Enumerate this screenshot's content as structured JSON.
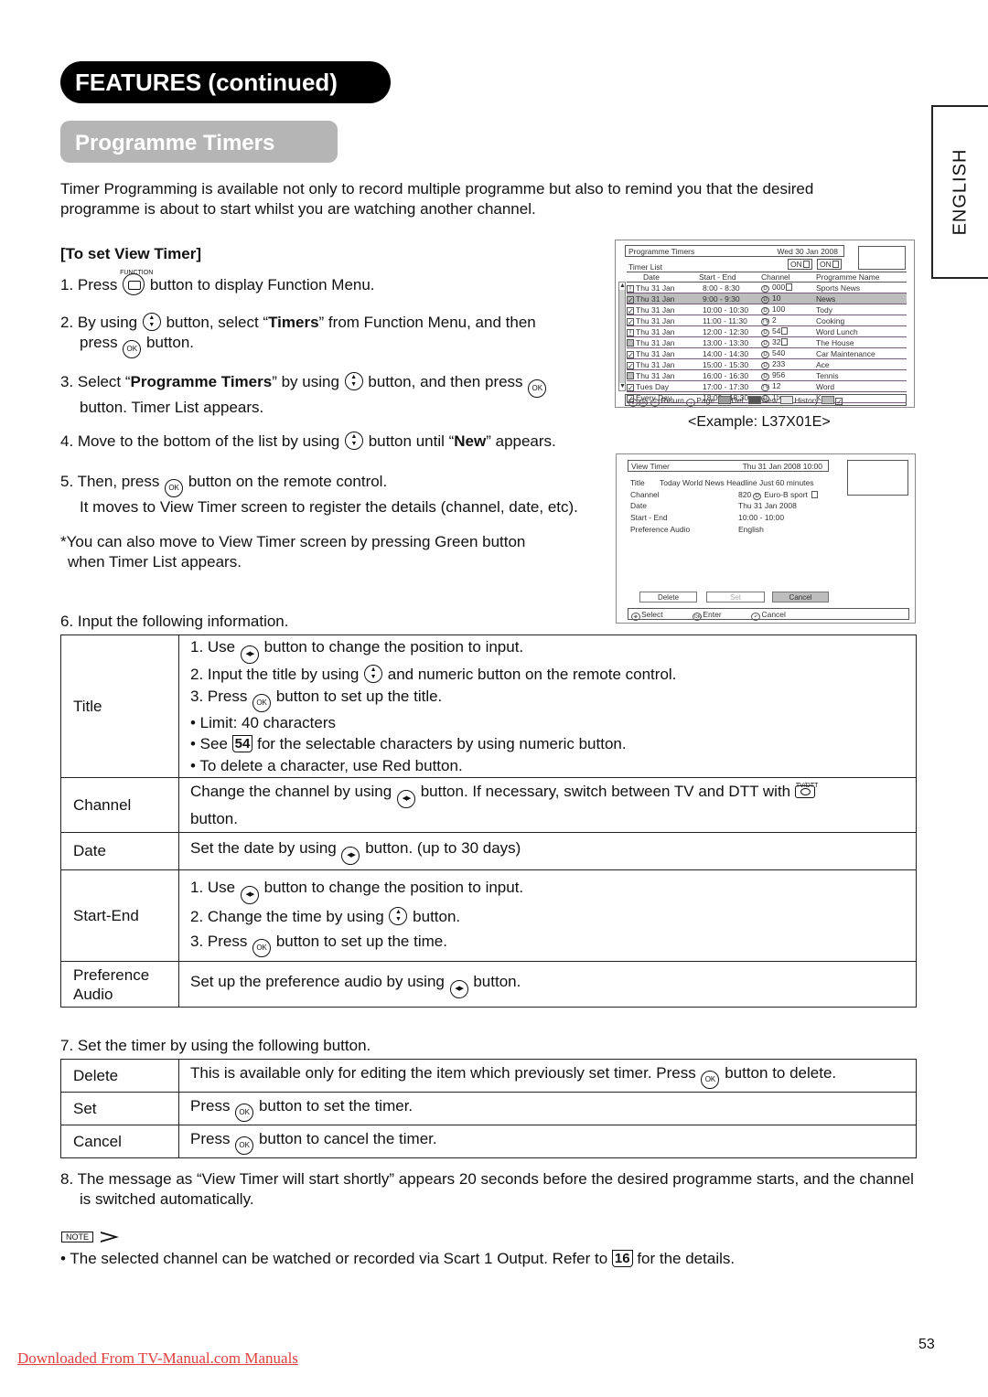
{
  "header": {
    "section_title": "FEATURES (continued)",
    "subsection_title": "Programme Timers",
    "language_tab": "ENGLISH"
  },
  "intro": "Timer Programming is available not only to record multiple programme but also to remind you that the desired programme is about to start whilst you are watching another channel.",
  "view_timer_heading": "[To set View Timer]",
  "icons": {
    "function_label": "FUNCTION",
    "ok_label": "OK",
    "tvdtt_label": "TV/DTT"
  },
  "steps": {
    "s1_a": "1. Press",
    "s1_b": "button to display Function Menu.",
    "s2_a": "2. By using",
    "s2_b": "button, select “",
    "s2_bold": "Timers",
    "s2_c": "” from Function Menu, and then",
    "s2_d": "press",
    "s2_e": "button.",
    "s3_a": "3. Select “",
    "s3_bold": "Programme Timers",
    "s3_b": "” by using",
    "s3_c": "button, and then press",
    "s3_d": "button. Timer List appears.",
    "s4_a": "4. Move to the bottom of the list by using",
    "s4_b": "button until “",
    "s4_bold": "New",
    "s4_c": "” appears.",
    "s5_a": "5. Then, press",
    "s5_b": "button on the remote control.",
    "s5_c": "It moves to View Timer screen to register the details (channel, date, etc).",
    "s5_note_1": "*You can also move to View Timer screen by pressing Green button",
    "s5_note_2": "when Timer List appears.",
    "s6": "6. Input the following information.",
    "s7": "7. Set the timer by using the following button.",
    "s8": "8. The message as “View Timer will start shortly” appears 20 seconds before the desired programme starts, and the channel is switched automatically."
  },
  "timer_list_screen": {
    "title": "Programme Timers",
    "date": "Wed 30 Jan 2008",
    "subtitle": "Timer List",
    "lock_badges": [
      "ON",
      "ON"
    ],
    "columns": [
      "Date",
      "Start - End",
      "Channel",
      "Programme Name"
    ],
    "rows": [
      {
        "mark": "!",
        "date": "Thu  31  Jan",
        "time": "8:00 -   8:30",
        "src": "D",
        "channel": "000",
        "lock": true,
        "name": "Sports News",
        "selected": false
      },
      {
        "mark": "check",
        "date": "Thu  31  Jan",
        "time": "9:00 -   9:30",
        "src": "D",
        "channel": "10",
        "lock": false,
        "name": "News",
        "selected": true
      },
      {
        "mark": "check",
        "date": "Thu  31  Jan",
        "time": "10:00 - 10:30",
        "src": "D",
        "channel": "100",
        "lock": false,
        "name": "Tody",
        "selected": false
      },
      {
        "mark": "check",
        "date": "Thu  31  Jan",
        "time": "11:00 - 11:30",
        "src": "TV",
        "channel": "2",
        "lock": false,
        "name": "Cooking",
        "selected": false
      },
      {
        "mark": "!",
        "date": "Thu  31  Jan",
        "time": "12:00 - 12:30",
        "src": "D",
        "channel": "54",
        "lock": true,
        "name": "Word Lunch",
        "selected": false
      },
      {
        "mark": "grey",
        "date": "Thu  31  Jan",
        "time": "13:00 - 13:30",
        "src": "D",
        "channel": "32",
        "lock": true,
        "name": "The House",
        "selected": false
      },
      {
        "mark": "check",
        "date": "Thu  31  Jan",
        "time": "14:00 - 14:30",
        "src": "D",
        "channel": "540",
        "lock": false,
        "name": "Car Maintenance",
        "selected": false
      },
      {
        "mark": "check",
        "date": "Thu  31  Jan",
        "time": "15:00 - 15:30",
        "src": "D",
        "channel": "233",
        "lock": false,
        "name": "Ace",
        "selected": false
      },
      {
        "mark": "grey",
        "date": "Thu  31  Jan",
        "time": "16:00 - 16:30",
        "src": "D",
        "channel": "956",
        "lock": false,
        "name": "Tennis",
        "selected": false
      },
      {
        "mark": "check",
        "date": "Tues Day",
        "time": "17:00 - 17:30",
        "src": "TV",
        "channel": "12",
        "lock": false,
        "name": "Word",
        "selected": false
      },
      {
        "mark": "check",
        "date": "Every Day",
        "time": "18:00 - 18:30",
        "src": "D",
        "channel": "15",
        "lock": false,
        "name": "K",
        "selected": false
      }
    ],
    "footer": {
      "ok": "OK",
      "return": "Return",
      "page": "Page",
      "del": "Del.",
      "new": "New",
      "history": "History"
    },
    "caption": "<Example: L37X01E>"
  },
  "view_timer_screen": {
    "title": "View Timer",
    "datetime": "Thu 31 Jan 2008    10:00",
    "title_label": "Title",
    "title_value": "Today World News Headline Just 60 minutes",
    "fields": [
      {
        "label": "Channel",
        "value": "820",
        "extra": "Euro-B sport"
      },
      {
        "label": "Date",
        "value": "Thu 31 Jan 2008",
        "extra": ""
      },
      {
        "label": "Start - End",
        "value": "10:00 - 10:00",
        "extra": ""
      },
      {
        "label": "Preference Audio",
        "value": "English",
        "extra": ""
      }
    ],
    "buttons": [
      "Delete",
      "Set",
      "Cancel"
    ],
    "footer": {
      "select": "Select",
      "ok": "OK",
      "enter": "Enter",
      "cancel": "Cancel"
    }
  },
  "input_table": {
    "title_label": "Title",
    "title_1a": "1. Use",
    "title_1b": "button to change the position to input.",
    "title_2a": "2. Input the title by using",
    "title_2b": "and numeric button on the remote control.",
    "title_3a": "3. Press",
    "title_3b": "button to set up the title.",
    "title_4": "• Limit: 40 characters",
    "title_5a": "• See",
    "title_5_ref": "54",
    "title_5b": "for the selectable characters by using numeric button.",
    "title_6": "• To delete a character, use Red button.",
    "channel_label": "Channel",
    "channel_a": "Change the channel by using",
    "channel_b": "button. If necessary, switch between TV and DTT with",
    "channel_c": "button.",
    "date_label": "Date",
    "date_a": "Set the date by using",
    "date_b": "button. (up to 30 days)",
    "startend_label": "Start-End",
    "se_1a": "1. Use",
    "se_1b": "button to change the position to input.",
    "se_2a": "2. Change the time by using",
    "se_2b": "button.",
    "se_3a": "3. Press",
    "se_3b": "button to set up the time.",
    "audio_label": "Preference Audio",
    "audio_a": "Set up the preference audio by using",
    "audio_b": "button."
  },
  "button_table": {
    "delete_label": "Delete",
    "delete_a": "This is available only for editing the item which previously set timer. Press",
    "delete_b": "button to delete.",
    "set_label": "Set",
    "set_a": "Press",
    "set_b": "button to set the timer.",
    "cancel_label": "Cancel",
    "cancel_a": "Press",
    "cancel_b": "button to cancel the timer."
  },
  "note": {
    "tag": "NOTE",
    "text_a": "• The selected channel can be watched or recorded via Scart 1 Output. Refer to",
    "ref": "16",
    "text_b": "for the details."
  },
  "page_number": "53",
  "download_link": "Downloaded From TV-Manual.com Manuals"
}
